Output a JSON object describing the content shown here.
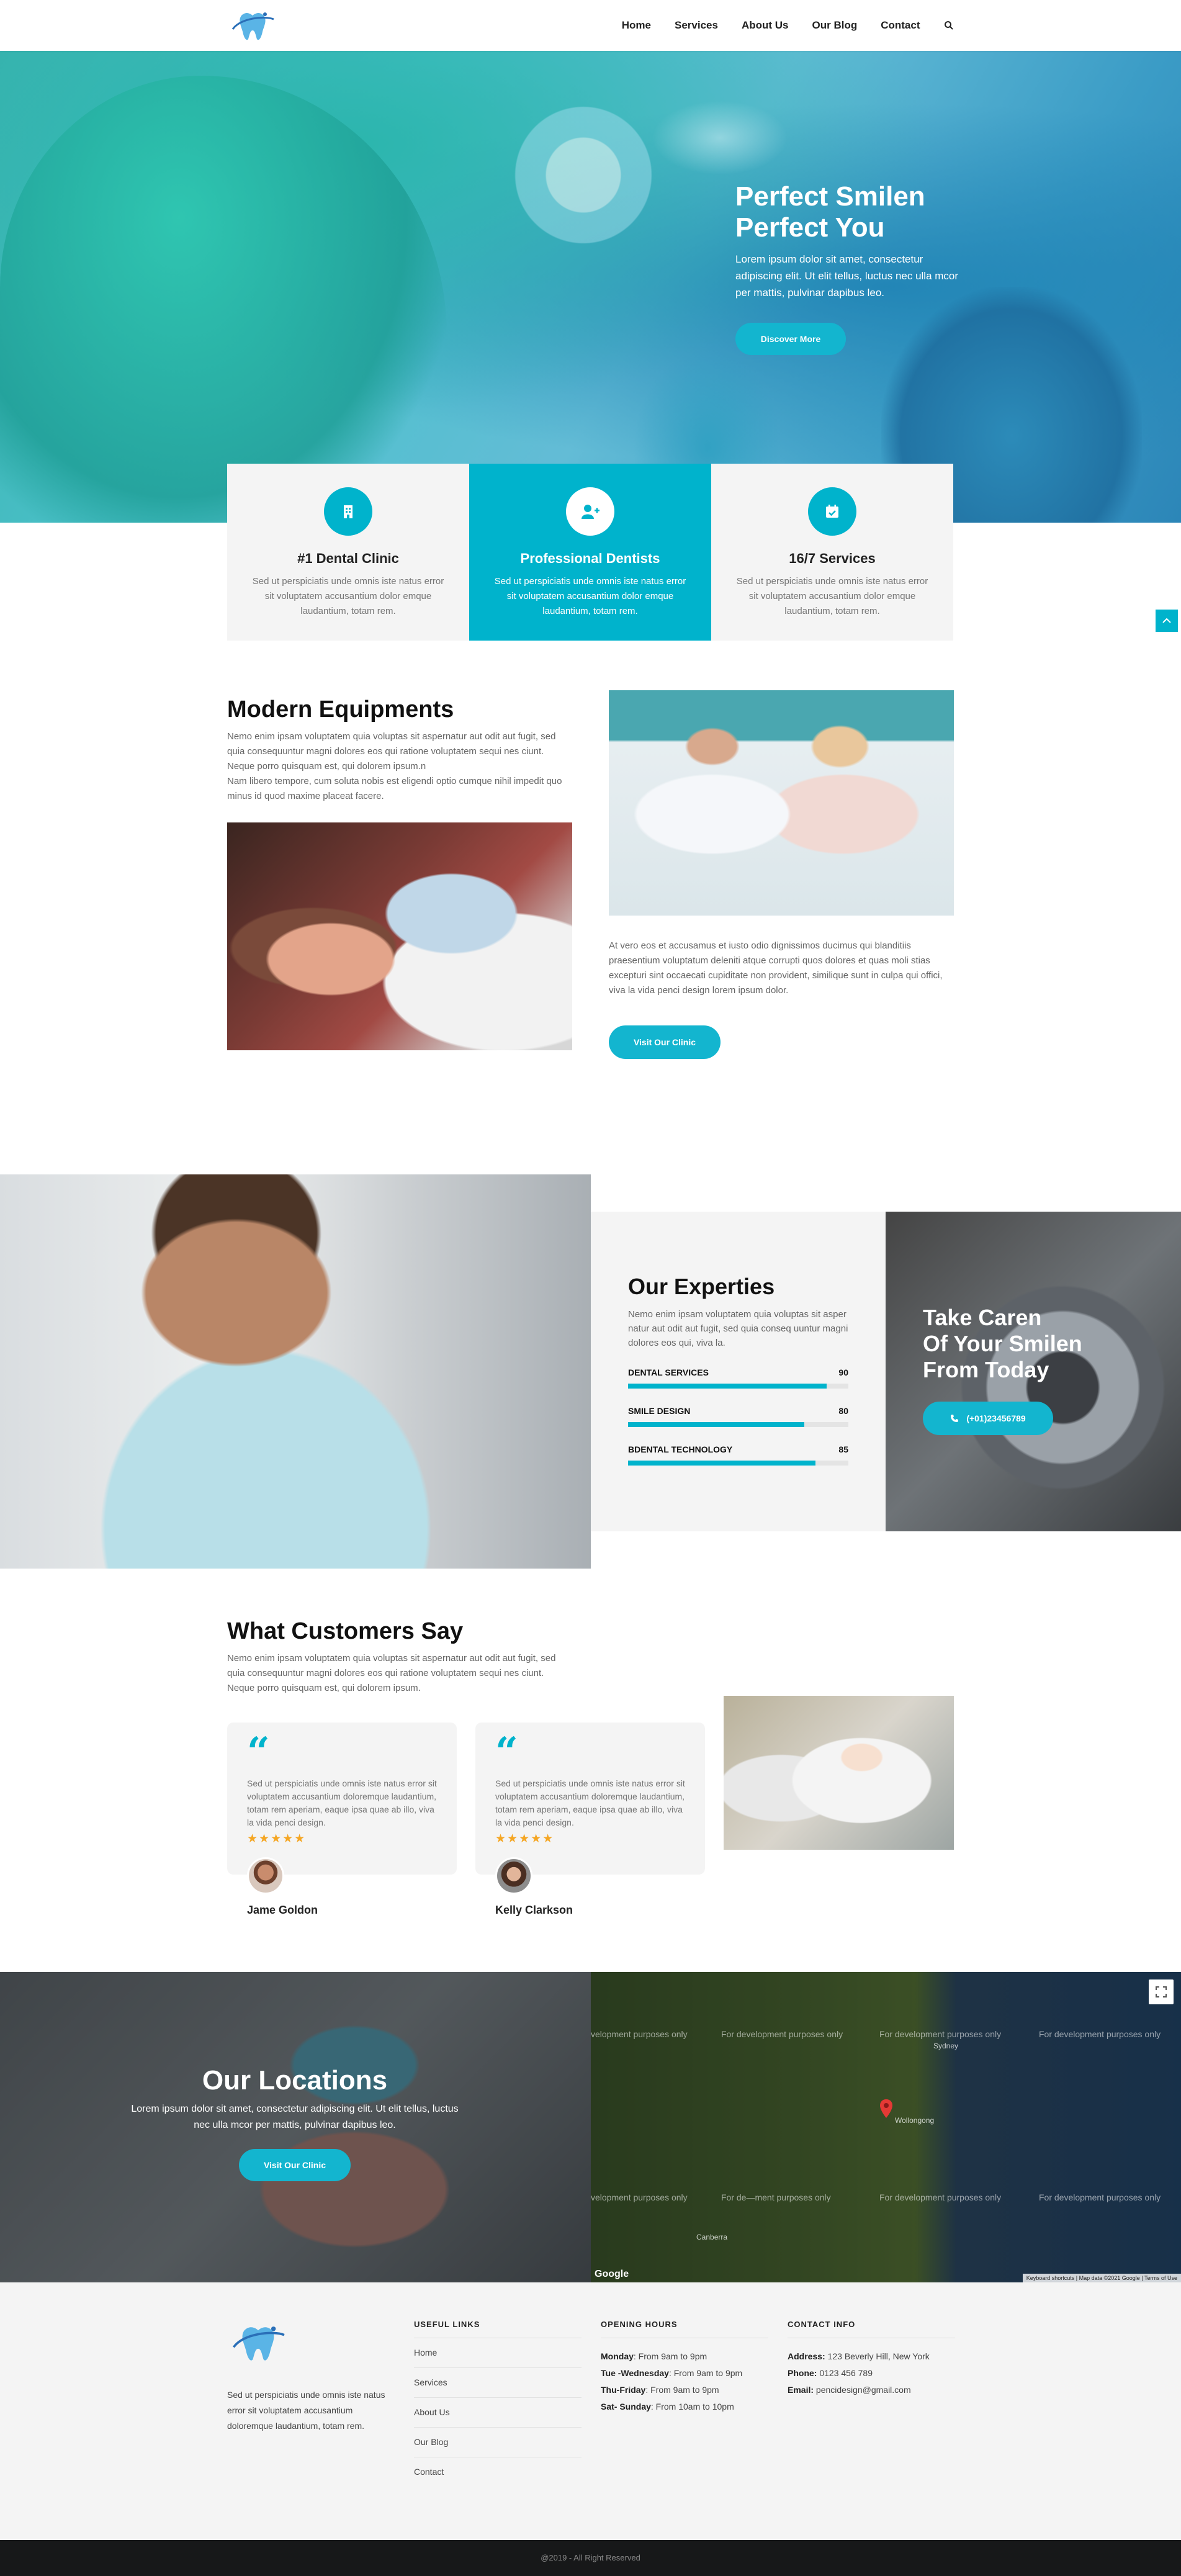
{
  "nav": {
    "items": [
      "Home",
      "Services",
      "About Us",
      "Our Blog",
      "Contact"
    ]
  },
  "hero": {
    "title_line1": "Perfect Smilen",
    "title_line2": "Perfect You",
    "text": "Lorem ipsum dolor sit amet, consectetur adipiscing elit. Ut elit tellus, luctus nec ulla mcor per mattis, pulvinar dapibus leo.",
    "button": "Discover More"
  },
  "features": [
    {
      "title": "#1 Dental Clinic",
      "text": "Sed ut perspiciatis unde omnis iste natus error sit voluptatem accusantium dolor emque laudantium, totam rem.",
      "icon": "building-icon"
    },
    {
      "title": "Professional Dentists",
      "text": "Sed ut perspiciatis unde omnis iste natus error sit voluptatem accusantium dolor emque laudantium, totam rem.",
      "icon": "user-plus-icon"
    },
    {
      "title": "16/7 Services",
      "text": "Sed ut perspiciatis unde omnis iste natus error sit voluptatem accusantium dolor emque laudantium, totam rem.",
      "icon": "calendar-icon"
    }
  ],
  "equipment": {
    "title": "Modern Equipments",
    "text": "Nemo enim ipsam voluptatem quia voluptas sit aspernatur aut odit aut fugit, sed quia consequuntur magni dolores eos qui ratione voluptatem sequi nes ciunt. Neque porro quisquam est, qui dolorem ipsum.n\nNam libero tempore, cum soluta nobis est eligendi optio cumque nihil impedit quo minus id quod maxime placeat facere.",
    "right_text": "At vero eos et accusamus et iusto odio dignissimos ducimus qui blanditiis praesentium voluptatum deleniti atque corrupti quos dolores et quas moli stias excepturi sint occaecati cupiditate non provident, similique sunt in culpa qui offici, viva la vida penci design lorem ipsum dolor.",
    "button": "Visit Our Clinic"
  },
  "expertise": {
    "title": "Our Experties",
    "text": "Nemo enim ipsam voluptatem quia voluptas sit asper natur aut odit aut fugit, sed quia conseq uuntur magni dolores eos qui, viva la.",
    "bars": [
      {
        "label": "DENTAL SERVICES",
        "value": 90
      },
      {
        "label": "SMILE DESIGN",
        "value": 80
      },
      {
        "label": "BDENTAL TECHNOLOGY",
        "value": 85
      }
    ],
    "cta_line1": "Take Caren",
    "cta_line2": "Of Your Smilen",
    "cta_line3": "From Today",
    "phone": "(+01)23456789"
  },
  "testimonials": {
    "title": "What Customers Say",
    "text": "Nemo enim ipsam voluptatem quia voluptas sit aspernatur aut odit aut fugit, sed quia consequuntur magni dolores eos qui ratione voluptatem sequi nes ciunt. Neque porro quisquam est, qui dolorem ipsum.",
    "quote_mark": "“",
    "items": [
      {
        "text": "Sed ut perspiciatis unde omnis iste natus error sit voluptatem accusantium doloremque laudantium, totam rem aperiam, eaque ipsa quae ab illo, viva la vida penci design.",
        "stars": "★★★★★",
        "name": "Jame Goldon"
      },
      {
        "text": "Sed ut perspiciatis unde omnis iste natus error sit voluptatem accusantium doloremque laudantium, totam rem aperiam, eaque ipsa quae ab illo, viva la vida penci design.",
        "stars": "★★★★★",
        "name": "Kelly Clarkson"
      }
    ]
  },
  "locations": {
    "title": "Our Locations",
    "text": "Lorem ipsum dolor sit amet, consectetur adipiscing elit. Ut elit tellus, luctus nec ulla mcor per mattis, pulvinar dapibus leo.",
    "button": "Visit Our Clinic"
  },
  "map": {
    "dev_text": "For development purposes only",
    "dev_partial_1": "velopment purposes only",
    "dev_partial_2": "For de—ment purposes only",
    "label_sydney": "Sydney",
    "label_wollongong": "Wollongong",
    "label_canberra": "Canberra",
    "google": "Google",
    "footer": "Keyboard shortcuts | Map data ©2021 Google | Terms of Use"
  },
  "footer": {
    "about": "Sed ut perspiciatis unde omnis iste natus error sit voluptatem accusantium doloremque laudantium, totam rem.",
    "useful_title": "USEFUL LINKS",
    "links": [
      "Home",
      "Services",
      "About Us",
      "Our Blog",
      "Contact"
    ],
    "hours_title": "OPENING HOURS",
    "hours": [
      {
        "day": "Monday",
        "time": ": From 9am to 9pm"
      },
      {
        "day": "Tue -Wednesday",
        "time": ": From 9am to 9pm"
      },
      {
        "day": "Thu-Friday",
        "time": ": From 9am to 9pm"
      },
      {
        "day": "Sat- Sunday",
        "time": ": From 10am to 10pm"
      }
    ],
    "contact_title": "CONTACT INFO",
    "contact": [
      {
        "label": "Address:",
        "value": " 123 Beverly Hill, New York"
      },
      {
        "label": "Phone:",
        "value": " 0123 456 789"
      },
      {
        "label": "Email:",
        "value": " pencidesign@gmail.com"
      }
    ],
    "copyright": "@2019 - All Right Reserved"
  },
  "colors": {
    "accent": "#00b3cc",
    "dark": "#171819"
  }
}
